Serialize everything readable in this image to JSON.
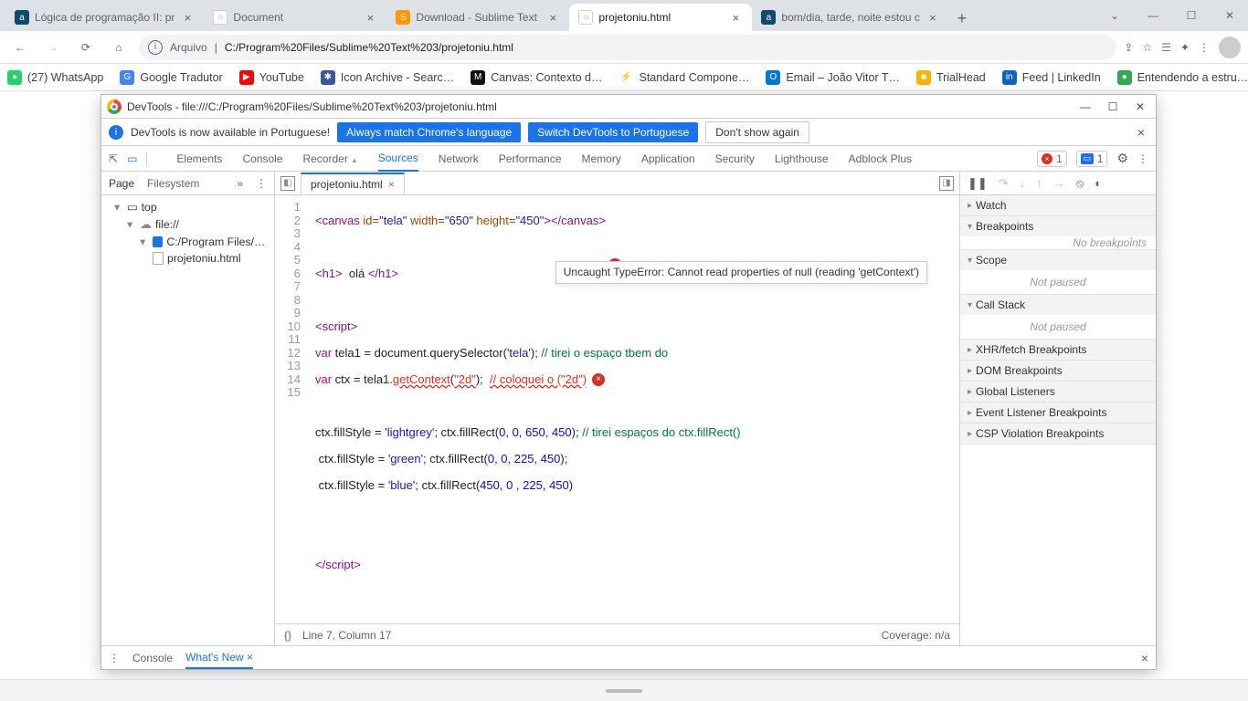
{
  "tabs": [
    {
      "title": "Lógica de programação II: pr",
      "fav": "a",
      "favbg": "#0a4b6e"
    },
    {
      "title": "Document",
      "fav": "○",
      "favbg": "#ccc"
    },
    {
      "title": "Download - Sublime Text",
      "fav": "S",
      "favbg": "#ff9800"
    },
    {
      "title": "projetoniu.html",
      "fav": "○",
      "favbg": "#ccc",
      "active": true
    },
    {
      "title": "bom/dia, tarde, noite estou c",
      "fav": "a",
      "favbg": "#0a4b6e"
    }
  ],
  "omnibox": {
    "scheme": "Arquivo",
    "sep": "|",
    "path": "C:/Program%20Files/Sublime%20Text%203/projetoniu.html"
  },
  "bookmarks": [
    {
      "label": "(27) WhatsApp",
      "bg": "#25d366",
      "g": "●"
    },
    {
      "label": "Google Tradutor",
      "bg": "#4285f4",
      "g": "G"
    },
    {
      "label": "YouTube",
      "bg": "#ff0000",
      "g": "▶"
    },
    {
      "label": "Icon Archive - Searc…",
      "bg": "#3b5998",
      "g": "✱"
    },
    {
      "label": "Canvas: Contexto d…",
      "bg": "#111",
      "g": "M"
    },
    {
      "label": "Standard Compone…",
      "bg": "#f7b500",
      "g": "⚡"
    },
    {
      "label": "Email – João Vitor T…",
      "bg": "#0078d4",
      "g": "O"
    },
    {
      "label": "TrialHead",
      "bg": "#f7b500",
      "g": "■"
    },
    {
      "label": "Feed | LinkedIn",
      "bg": "#0a66c2",
      "g": "in"
    },
    {
      "label": "Entendendo a estru…",
      "bg": "#34a853",
      "g": "●"
    }
  ],
  "devtools": {
    "title": "DevTools - file:///C:/Program%20Files/Sublime%20Text%203/projetoniu.html",
    "banner": {
      "msg": "DevTools is now available in Portuguese!",
      "b1": "Always match Chrome's language",
      "b2": "Switch DevTools to Portuguese",
      "b3": "Don't show again"
    },
    "panels": [
      "Elements",
      "Console",
      "Recorder",
      "Sources",
      "Network",
      "Performance",
      "Memory",
      "Application",
      "Security",
      "Lighthouse",
      "Adblock Plus"
    ],
    "activePanel": "Sources",
    "errCount": "1",
    "msgCount": "1",
    "nav": {
      "tabs": [
        "Page",
        "Filesystem"
      ],
      "top": "top",
      "file": "file://",
      "folder": "C:/Program Files/Sublime",
      "leaf": "projetoniu.html"
    },
    "openFile": "projetoniu.html",
    "error": "Uncaught TypeError: Cannot read properties of null (reading 'getContext')",
    "status": {
      "pos": "Line 7, Column 17",
      "coverage": "Coverage: n/a"
    },
    "dbg": {
      "watch": "Watch",
      "bp": "Breakpoints",
      "nobp": "No breakpoints",
      "scope": "Scope",
      "np": "Not paused",
      "cs": "Call Stack",
      "xhr": "XHR/fetch Breakpoints",
      "dom": "DOM Breakpoints",
      "gl": "Global Listeners",
      "ev": "Event Listener Breakpoints",
      "csp": "CSP Violation Breakpoints"
    },
    "drawer": {
      "console": "Console",
      "whatsnew": "What's New"
    }
  },
  "code": {
    "l1a": "<canvas",
    "l1b": " id=",
    "l1c": "\"tela\"",
    "l1d": " width=",
    "l1e": "\"650\"",
    "l1f": " height=",
    "l1g": "\"450\"",
    "l1h": "></canvas>",
    "l3a": "<h1>",
    "l3b": "  olá ",
    "l3c": "</h1>",
    "l5a": "<script>",
    "l6a": "var",
    "l6b": " tela1 = document.querySelector(",
    "l6c": "'tela'",
    "l6d": "); ",
    "l6e": "// tirei o espaço tbem do",
    "l7a": "var",
    "l7b": " ctx = tela1.",
    "l7c": "getContext",
    "l7d": "(",
    "l7e": "\"2d\"",
    "l7f": ");  ",
    "l7g": "// coloquei o (\"2d\")",
    "l9a": "ctx.fillStyle = ",
    "l9b": "'lightgrey'",
    "l9c": "; ctx.fillRect(",
    "l9d": "0, 0, 650, 450",
    "l9e": "); ",
    "l9f": "// tirei espaços do ctx.fillRect()",
    "l10a": " ctx.fillStyle = ",
    "l10b": "'green'",
    "l10c": "; ctx.fillRect(",
    "l10d": "0, 0, 225, 450",
    "l10e": ");",
    "l11a": " ctx.fillStyle = ",
    "l11b": "'blue'",
    "l11c": "; ctx.fillRect(",
    "l11d": "450, 0 , 225, 450",
    "l11e": ")",
    "l15a": "</script>"
  },
  "linenums": [
    "1",
    "2",
    "3",
    "4",
    "5",
    "6",
    "7",
    "8",
    "9",
    "10",
    "11",
    "12",
    "13",
    "14",
    "15"
  ]
}
